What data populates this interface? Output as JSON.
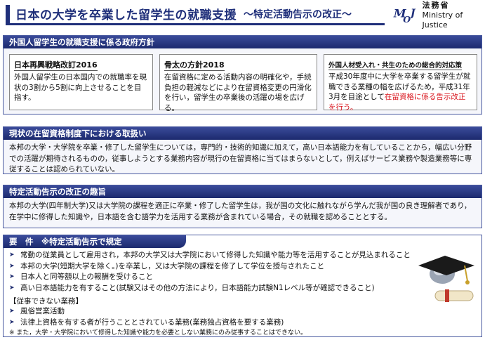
{
  "header": {
    "title": "日本の大学を卒業した留学生の就職支援",
    "subtitle": "〜特定活動告示の改正〜"
  },
  "logo": {
    "mark": "MOJ",
    "name_jp": "法務省",
    "name_en": "Ministry of Justice"
  },
  "policy": {
    "heading": "外国人留学生の就職支援に係る政府方針",
    "boxes": [
      {
        "title": "日本再興戦略改訂2016",
        "text": "外国人留学生の日本国内での就職率を現状の3割から5割に向上させることを目指す。"
      },
      {
        "title": "骨太の方針2018",
        "text": "在留資格に定める活動内容の明確化や，手続負担の軽減などにより在留資格変更の円滑化を行い，留学生の卒業後の活躍の場を広げる。"
      },
      {
        "title": "外国人材受入れ・共生のための総合的対応策",
        "text": "平成30年度中に大学を卒業する留学生が就職できる業種の幅を広げるため，平成31年3月を目途として",
        "text_highlight": "在留資格に係る告示改正を行う。"
      }
    ]
  },
  "current": {
    "heading": "現状の在留資格制度下における取扱い",
    "body": "本邦の大学・大学院を卒業・修了した留学生については，専門的・技術的知識に加えて，高い日本語能力を有していることから，幅広い分野での活躍が期待されるものの，従事しようとする業務内容が現行の在留資格に当てはまらないとして，例えばサービス業務や製造業務等に専従することは認められていない。"
  },
  "purpose": {
    "heading": "特定活動告示の改正の趣旨",
    "body": "本邦の大学(四年制大学)又は大学院の課程を適正に卒業・修了した留学生は，我が国の文化に触れながら学んだ我が国の良き理解者であり，在学中に修得した知識や，日本語を含む語学力を活用する業務が含まれている場合，その就職を認めることとする。"
  },
  "requirements": {
    "heading": "要　件　※特定活動告示で規定",
    "items": [
      "常勤の従業員として雇用され，本邦の大学又は大学院において修得した知識や能力等を活用することが見込まれること",
      "本邦の大学(短期大学を除く。)を卒業し，又は大学院の課程を修了して学位を授与されたこと",
      "日本人と同等額以上の報酬を受けること",
      "高い日本語能力を有すること(試験又はその他の方法により，日本語能力試験N1レベル等が確認できること)"
    ],
    "prohibited_heading": "【従事できない業務】",
    "prohibited": [
      "風俗営業活動",
      "法律上資格を有する者が行うこととされている業務(業務独占資格を要する業務)"
    ],
    "note": "※ また，大学・大学院において修得した知識や能力を必要としない業務にのみ従事することはできない。"
  },
  "colors": {
    "navy": "#1f2f7a",
    "highlight_red": "#d9161e"
  },
  "icons": [
    "graduation-cap-icon",
    "diploma-scroll-icon"
  ]
}
